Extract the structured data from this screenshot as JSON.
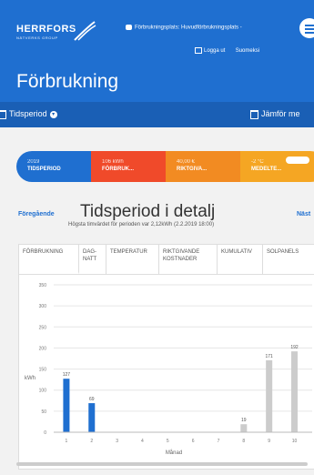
{
  "header": {
    "logo_name": "HERRFORS",
    "logo_sub": "NÄTVERKS GROUP",
    "usage_location": "Förbrukningsplats: Huvudförbrukningsplats -",
    "logout": "Logga ut",
    "language": "Suomeksi",
    "page_title": "Förbrukning"
  },
  "subbar": {
    "period_label": "Tidsperiod",
    "compare_label": "Jämför me"
  },
  "summary": [
    {
      "value": "2019",
      "label": "TIDSPERIOD",
      "color": "#1f6fd0"
    },
    {
      "value": "106 kWh",
      "label": "FÖRBRUK...",
      "color": "#f04a2a"
    },
    {
      "value": "40,00 €",
      "label": "RIKTGIVA...",
      "color": "#f28b22"
    },
    {
      "value": "-2 °C",
      "label": "MEDELTE...",
      "color": "#f5a623"
    }
  ],
  "section": {
    "prev": "Föregående",
    "next": "Näst",
    "title": "Tidsperiod i detalj",
    "subtitle": "Högsta timvärdet för perioden var 2,12kWh (2.2.2019 18:00)"
  },
  "tabs": [
    "FÖRBRUKNING",
    "DAG- NATT",
    "TEMPERATUR",
    "RIKTGIVANDE KOSTNADER",
    "KUMULATIV",
    "SOLPANELS"
  ],
  "chart_data": {
    "type": "bar",
    "categories": [
      "1",
      "2",
      "3",
      "4",
      "5",
      "6",
      "7",
      "8",
      "9",
      "10"
    ],
    "values": [
      127,
      69,
      0,
      0,
      0,
      0,
      0,
      19,
      171,
      192
    ],
    "data_labels": [
      "127",
      "69",
      "",
      "",
      "",
      "",
      "",
      "19",
      "171",
      "192"
    ],
    "bar_colors": [
      "#1f6fd0",
      "#1f6fd0",
      "#cccccc",
      "#cccccc",
      "#cccccc",
      "#cccccc",
      "#cccccc",
      "#cccccc",
      "#cccccc",
      "#cccccc"
    ],
    "ylabel": "kWh",
    "xlabel": "Månad",
    "yticks": [
      "0",
      "50",
      "100",
      "150",
      "200",
      "250",
      "300",
      "350"
    ],
    "ylim": [
      0,
      350
    ],
    "grid": true
  }
}
